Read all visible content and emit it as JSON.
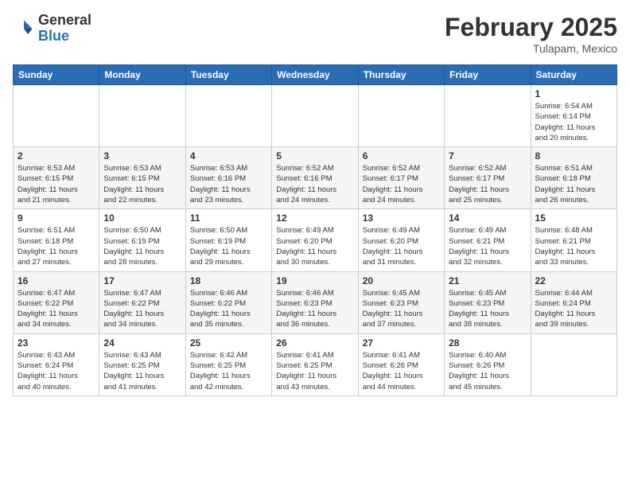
{
  "header": {
    "logo_general": "General",
    "logo_blue": "Blue",
    "title": "February 2025",
    "location": "Tulapam, Mexico"
  },
  "days_of_week": [
    "Sunday",
    "Monday",
    "Tuesday",
    "Wednesday",
    "Thursday",
    "Friday",
    "Saturday"
  ],
  "weeks": [
    {
      "days": [
        {
          "num": "",
          "info": ""
        },
        {
          "num": "",
          "info": ""
        },
        {
          "num": "",
          "info": ""
        },
        {
          "num": "",
          "info": ""
        },
        {
          "num": "",
          "info": ""
        },
        {
          "num": "",
          "info": ""
        },
        {
          "num": "1",
          "info": "Sunrise: 6:54 AM\nSunset: 6:14 PM\nDaylight: 11 hours\nand 20 minutes."
        }
      ]
    },
    {
      "days": [
        {
          "num": "2",
          "info": "Sunrise: 6:53 AM\nSunset: 6:15 PM\nDaylight: 11 hours\nand 21 minutes."
        },
        {
          "num": "3",
          "info": "Sunrise: 6:53 AM\nSunset: 6:15 PM\nDaylight: 11 hours\nand 22 minutes."
        },
        {
          "num": "4",
          "info": "Sunrise: 6:53 AM\nSunset: 6:16 PM\nDaylight: 11 hours\nand 23 minutes."
        },
        {
          "num": "5",
          "info": "Sunrise: 6:52 AM\nSunset: 6:16 PM\nDaylight: 11 hours\nand 24 minutes."
        },
        {
          "num": "6",
          "info": "Sunrise: 6:52 AM\nSunset: 6:17 PM\nDaylight: 11 hours\nand 24 minutes."
        },
        {
          "num": "7",
          "info": "Sunrise: 6:52 AM\nSunset: 6:17 PM\nDaylight: 11 hours\nand 25 minutes."
        },
        {
          "num": "8",
          "info": "Sunrise: 6:51 AM\nSunset: 6:18 PM\nDaylight: 11 hours\nand 26 minutes."
        }
      ]
    },
    {
      "days": [
        {
          "num": "9",
          "info": "Sunrise: 6:51 AM\nSunset: 6:18 PM\nDaylight: 11 hours\nand 27 minutes."
        },
        {
          "num": "10",
          "info": "Sunrise: 6:50 AM\nSunset: 6:19 PM\nDaylight: 11 hours\nand 28 minutes."
        },
        {
          "num": "11",
          "info": "Sunrise: 6:50 AM\nSunset: 6:19 PM\nDaylight: 11 hours\nand 29 minutes."
        },
        {
          "num": "12",
          "info": "Sunrise: 6:49 AM\nSunset: 6:20 PM\nDaylight: 11 hours\nand 30 minutes."
        },
        {
          "num": "13",
          "info": "Sunrise: 6:49 AM\nSunset: 6:20 PM\nDaylight: 11 hours\nand 31 minutes."
        },
        {
          "num": "14",
          "info": "Sunrise: 6:49 AM\nSunset: 6:21 PM\nDaylight: 11 hours\nand 32 minutes."
        },
        {
          "num": "15",
          "info": "Sunrise: 6:48 AM\nSunset: 6:21 PM\nDaylight: 11 hours\nand 33 minutes."
        }
      ]
    },
    {
      "days": [
        {
          "num": "16",
          "info": "Sunrise: 6:47 AM\nSunset: 6:22 PM\nDaylight: 11 hours\nand 34 minutes."
        },
        {
          "num": "17",
          "info": "Sunrise: 6:47 AM\nSunset: 6:22 PM\nDaylight: 11 hours\nand 34 minutes."
        },
        {
          "num": "18",
          "info": "Sunrise: 6:46 AM\nSunset: 6:22 PM\nDaylight: 11 hours\nand 35 minutes."
        },
        {
          "num": "19",
          "info": "Sunrise: 6:46 AM\nSunset: 6:23 PM\nDaylight: 11 hours\nand 36 minutes."
        },
        {
          "num": "20",
          "info": "Sunrise: 6:45 AM\nSunset: 6:23 PM\nDaylight: 11 hours\nand 37 minutes."
        },
        {
          "num": "21",
          "info": "Sunrise: 6:45 AM\nSunset: 6:23 PM\nDaylight: 11 hours\nand 38 minutes."
        },
        {
          "num": "22",
          "info": "Sunrise: 6:44 AM\nSunset: 6:24 PM\nDaylight: 11 hours\nand 39 minutes."
        }
      ]
    },
    {
      "days": [
        {
          "num": "23",
          "info": "Sunrise: 6:43 AM\nSunset: 6:24 PM\nDaylight: 11 hours\nand 40 minutes."
        },
        {
          "num": "24",
          "info": "Sunrise: 6:43 AM\nSunset: 6:25 PM\nDaylight: 11 hours\nand 41 minutes."
        },
        {
          "num": "25",
          "info": "Sunrise: 6:42 AM\nSunset: 6:25 PM\nDaylight: 11 hours\nand 42 minutes."
        },
        {
          "num": "26",
          "info": "Sunrise: 6:41 AM\nSunset: 6:25 PM\nDaylight: 11 hours\nand 43 minutes."
        },
        {
          "num": "27",
          "info": "Sunrise: 6:41 AM\nSunset: 6:26 PM\nDaylight: 11 hours\nand 44 minutes."
        },
        {
          "num": "28",
          "info": "Sunrise: 6:40 AM\nSunset: 6:26 PM\nDaylight: 11 hours\nand 45 minutes."
        },
        {
          "num": "",
          "info": ""
        }
      ]
    }
  ]
}
